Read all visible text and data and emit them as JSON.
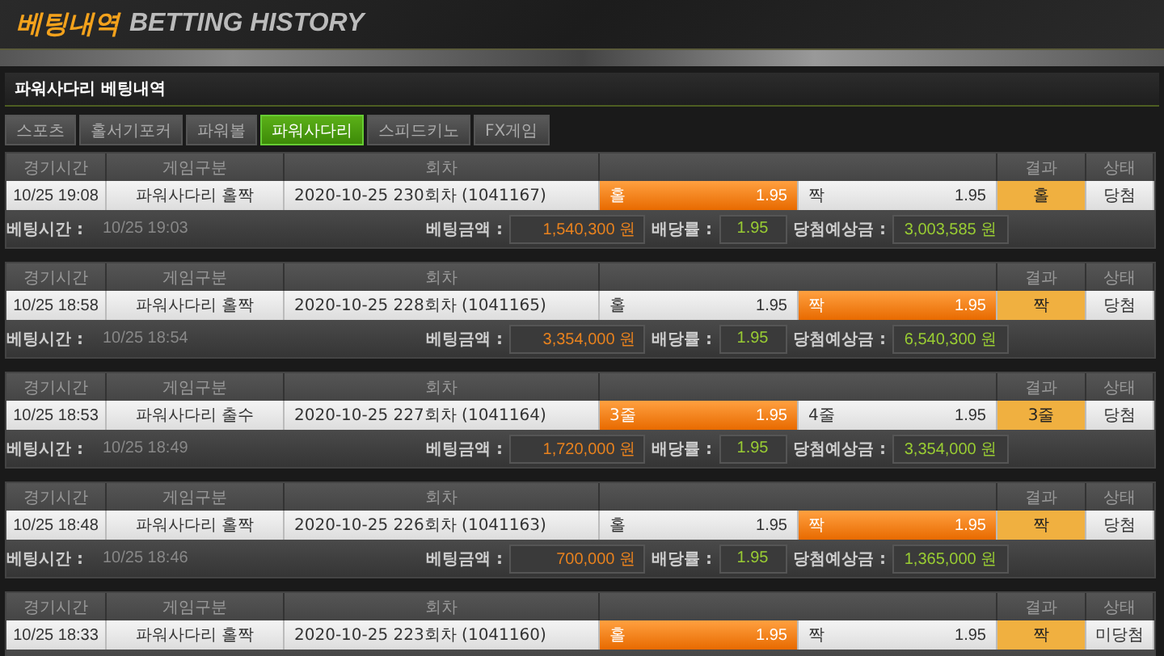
{
  "header": {
    "title_ko": "베팅내역",
    "title_en": "BETTING HISTORY"
  },
  "section_title": "파워사다리 베팅내역",
  "tabs": [
    {
      "label": "스포츠",
      "selected": false
    },
    {
      "label": "홀서기포커",
      "selected": false
    },
    {
      "label": "파워볼",
      "selected": false
    },
    {
      "label": "파워사다리",
      "selected": true
    },
    {
      "label": "스피드키노",
      "selected": false
    },
    {
      "label": "FX게임",
      "selected": false
    }
  ],
  "bets": [
    {
      "columns": {
        "time": "경기시간",
        "game": "게임구분",
        "round": "회차",
        "result": "결과",
        "status": "상태"
      },
      "time": "10/25 19:08",
      "game": "파워사다리 홀짝",
      "round": "2020-10-25 230회차 (1041167)",
      "options": [
        {
          "label": "홀",
          "odds": "1.95",
          "selected": true
        },
        {
          "label": "짝",
          "odds": "1.95",
          "selected": false
        }
      ],
      "result": "홀",
      "status": "당첨",
      "bet_info": {
        "bet_time_label": "베팅시간 :",
        "bet_time": "10/25 19:03",
        "amount_label": "베팅금액 :",
        "amount": "1,540,300 원",
        "odds_label": "배당률 :",
        "odds": "1.95",
        "expected_label": "당첨예상금 :",
        "expected": "3,003,585 원"
      }
    },
    {
      "columns": {
        "time": "경기시간",
        "game": "게임구분",
        "round": "회차",
        "result": "결과",
        "status": "상태"
      },
      "time": "10/25 18:58",
      "game": "파워사다리 홀짝",
      "round": "2020-10-25 228회차 (1041165)",
      "options": [
        {
          "label": "홀",
          "odds": "1.95",
          "selected": false
        },
        {
          "label": "짝",
          "odds": "1.95",
          "selected": true
        }
      ],
      "result": "짝",
      "status": "당첨",
      "bet_info": {
        "bet_time_label": "베팅시간 :",
        "bet_time": "10/25 18:54",
        "amount_label": "베팅금액 :",
        "amount": "3,354,000 원",
        "odds_label": "배당률 :",
        "odds": "1.95",
        "expected_label": "당첨예상금 :",
        "expected": "6,540,300 원"
      }
    },
    {
      "columns": {
        "time": "경기시간",
        "game": "게임구분",
        "round": "회차",
        "result": "결과",
        "status": "상태"
      },
      "time": "10/25 18:53",
      "game": "파워사다리 출수",
      "round": "2020-10-25 227회차 (1041164)",
      "options": [
        {
          "label": "3줄",
          "odds": "1.95",
          "selected": true
        },
        {
          "label": "4줄",
          "odds": "1.95",
          "selected": false
        }
      ],
      "result": "3줄",
      "status": "당첨",
      "bet_info": {
        "bet_time_label": "베팅시간 :",
        "bet_time": "10/25 18:49",
        "amount_label": "베팅금액 :",
        "amount": "1,720,000 원",
        "odds_label": "배당률 :",
        "odds": "1.95",
        "expected_label": "당첨예상금 :",
        "expected": "3,354,000 원"
      }
    },
    {
      "columns": {
        "time": "경기시간",
        "game": "게임구분",
        "round": "회차",
        "result": "결과",
        "status": "상태"
      },
      "time": "10/25 18:48",
      "game": "파워사다리 홀짝",
      "round": "2020-10-25 226회차 (1041163)",
      "options": [
        {
          "label": "홀",
          "odds": "1.95",
          "selected": false
        },
        {
          "label": "짝",
          "odds": "1.95",
          "selected": true
        }
      ],
      "result": "짝",
      "status": "당첨",
      "bet_info": {
        "bet_time_label": "베팅시간 :",
        "bet_time": "10/25 18:46",
        "amount_label": "베팅금액 :",
        "amount": "700,000 원",
        "odds_label": "배당률 :",
        "odds": "1.95",
        "expected_label": "당첨예상금 :",
        "expected": "1,365,000 원"
      }
    },
    {
      "columns": {
        "time": "경기시간",
        "game": "게임구분",
        "round": "회차",
        "result": "결과",
        "status": "상태"
      },
      "time": "10/25 18:33",
      "game": "파워사다리 홀짝",
      "round": "2020-10-25 223회차 (1041160)",
      "options": [
        {
          "label": "홀",
          "odds": "1.95",
          "selected": true
        },
        {
          "label": "짝",
          "odds": "1.95",
          "selected": false
        }
      ],
      "result": "짝",
      "status": "미당첨"
    }
  ]
}
